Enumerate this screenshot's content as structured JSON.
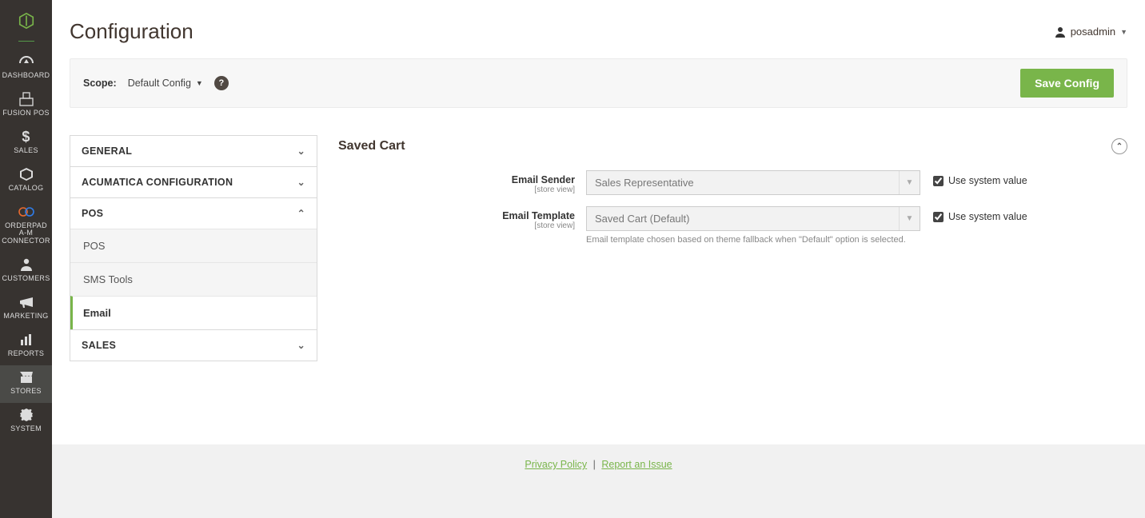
{
  "sidebar": {
    "items": [
      {
        "label": "DASHBOARD"
      },
      {
        "label": "FUSION POS"
      },
      {
        "label": "SALES"
      },
      {
        "label": "CATALOG"
      },
      {
        "label": "ORDERPAD A-M CONNECTOR"
      },
      {
        "label": "CUSTOMERS"
      },
      {
        "label": "MARKETING"
      },
      {
        "label": "REPORTS"
      },
      {
        "label": "STORES"
      },
      {
        "label": "SYSTEM"
      }
    ]
  },
  "page": {
    "title": "Configuration"
  },
  "user": {
    "name": "posadmin"
  },
  "scope": {
    "label": "Scope:",
    "value": "Default Config"
  },
  "buttons": {
    "save": "Save Config"
  },
  "config_nav": {
    "groups": [
      {
        "label": "GENERAL",
        "expanded": false
      },
      {
        "label": "ACUMATICA CONFIGURATION",
        "expanded": false
      },
      {
        "label": "POS",
        "expanded": true,
        "items": [
          {
            "label": "POS",
            "active": false
          },
          {
            "label": "SMS Tools",
            "active": false
          },
          {
            "label": "Email",
            "active": true
          }
        ]
      },
      {
        "label": "SALES",
        "expanded": false
      }
    ]
  },
  "panel": {
    "section_title": "Saved Cart",
    "rows": [
      {
        "label": "Email Sender",
        "sub": "[store view]",
        "value": "Sales Representative",
        "use_system_label": "Use system value",
        "use_system_checked": true,
        "hint": ""
      },
      {
        "label": "Email Template",
        "sub": "[store view]",
        "value": "Saved Cart (Default)",
        "use_system_label": "Use system value",
        "use_system_checked": true,
        "hint": "Email template chosen based on theme fallback when \"Default\" option is selected."
      }
    ]
  },
  "footer": {
    "privacy": "Privacy Policy",
    "report": "Report an Issue"
  }
}
